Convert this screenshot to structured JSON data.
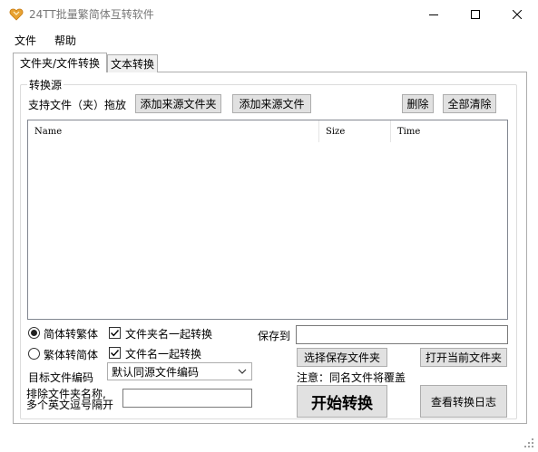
{
  "window": {
    "title": "24TT批量繁简体互转软件",
    "icon": "heart-app-icon"
  },
  "menu": {
    "items": [
      {
        "label": "文件"
      },
      {
        "label": "帮助"
      }
    ]
  },
  "tabs": [
    {
      "label": "文件夹/文件转换",
      "active": true
    },
    {
      "label": "文本转换",
      "active": false
    }
  ],
  "source_group": {
    "title": "转换源",
    "drag_label": "支持文件（夹）拖放",
    "add_folder_button": "添加来源文件夹",
    "add_file_button": "添加来源文件",
    "delete_button": "删除",
    "clear_all_button": "全部清除"
  },
  "file_list": {
    "columns": [
      "Name",
      "Size",
      "Time"
    ],
    "rows": []
  },
  "options": {
    "radio_trad_to_simp": {
      "label": "简体转繁体",
      "checked": true
    },
    "radio_simp_to_trad": {
      "label": "繁体转简体",
      "checked": false
    },
    "check_folder_names": {
      "label": "文件夹名一起转换",
      "checked": true
    },
    "check_file_names": {
      "label": "文件名一起转换",
      "checked": true
    },
    "encoding_label": "目标文件编码",
    "encoding_value": "默认同源文件编码",
    "exclude_label_line1": "排除文件夹名称,",
    "exclude_label_line2": "多个英文逗号隔开",
    "exclude_value": ""
  },
  "output": {
    "save_label": "保存到",
    "save_path": "",
    "choose_save_button": "选择保存文件夹",
    "open_folder_button": "打开当前文件夹",
    "note": "注意：同名文件将覆盖",
    "start_button": "开始转换",
    "view_log_button": "查看转换日志"
  },
  "colors": {
    "button_bg": "#e1e1e1",
    "border": "#adadad",
    "title_text": "#777777"
  }
}
